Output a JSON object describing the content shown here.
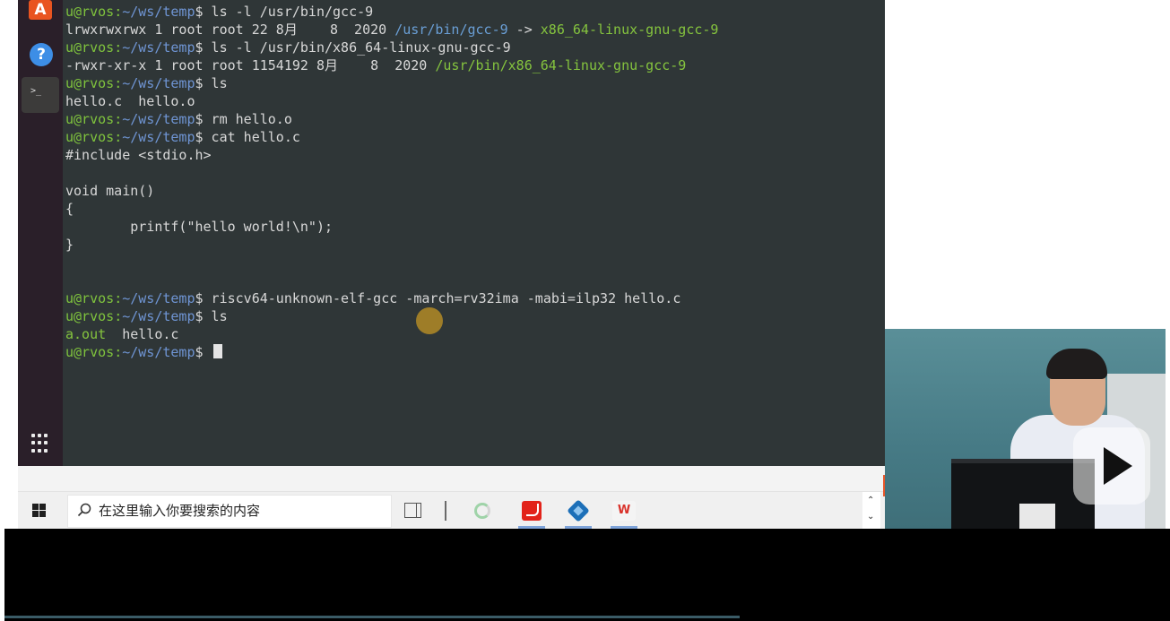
{
  "terminal": {
    "lines": [
      {
        "user": "u@rvos",
        "path": "~/ws/temp",
        "cmd": " ls -l /usr/bin/gcc-9"
      },
      {
        "plain": "lrwxrwxrwx 1 root root 22 8月    8  2020 ",
        "link": "/usr/bin/gcc-9",
        "arrow": " -> ",
        "target": "x86_64-linux-gnu-gcc-9"
      },
      {
        "user": "u@rvos",
        "path": "~/ws/temp",
        "cmd": " ls -l /usr/bin/x86_64-linux-gnu-gcc-9"
      },
      {
        "plain": "-rwxr-xr-x 1 root root 1154192 8月    8  2020 ",
        "target": "/usr/bin/x86_64-linux-gnu-gcc-9"
      },
      {
        "user": "u@rvos",
        "path": "~/ws/temp",
        "cmd": " ls"
      },
      {
        "plain": "hello.c  hello.o"
      },
      {
        "user": "u@rvos",
        "path": "~/ws/temp",
        "cmd": " rm hello.o"
      },
      {
        "user": "u@rvos",
        "path": "~/ws/temp",
        "cmd": " cat hello.c"
      },
      {
        "plain": "#include <stdio.h>"
      },
      {
        "plain": ""
      },
      {
        "plain": "void main()"
      },
      {
        "plain": "{"
      },
      {
        "plain": "        printf(\"hello world!\\n\");"
      },
      {
        "plain": "}"
      },
      {
        "plain": ""
      },
      {
        "plain": ""
      },
      {
        "user": "u@rvos",
        "path": "~/ws/temp",
        "cmd": " riscv64-unknown-elf-gcc -march=rv32ima -mabi=ilp32 hello.c"
      },
      {
        "user": "u@rvos",
        "path": "~/ws/temp",
        "cmd": " ls"
      },
      {
        "green": "a.out",
        "plain": "  hello.c"
      },
      {
        "user": "u@rvos",
        "path": "~/ws/temp",
        "cmd": " ",
        "cursor": true
      }
    ]
  },
  "taskbar": {
    "search_placeholder": "在这里输入你要搜索的内容",
    "apps": [
      "task-view",
      "wechat",
      "pdf-reader",
      "virtualbox",
      "wps"
    ]
  },
  "dock": {
    "software_label": "A",
    "help_label": "?",
    "terminal_label": ">_"
  },
  "colors": {
    "terminal_bg": "#2f3637",
    "prompt_user": "#7fc33d",
    "prompt_path": "#6f95d4",
    "dock_bg": "#2a1f29",
    "taskbar_bg": "#f0f0f0"
  }
}
